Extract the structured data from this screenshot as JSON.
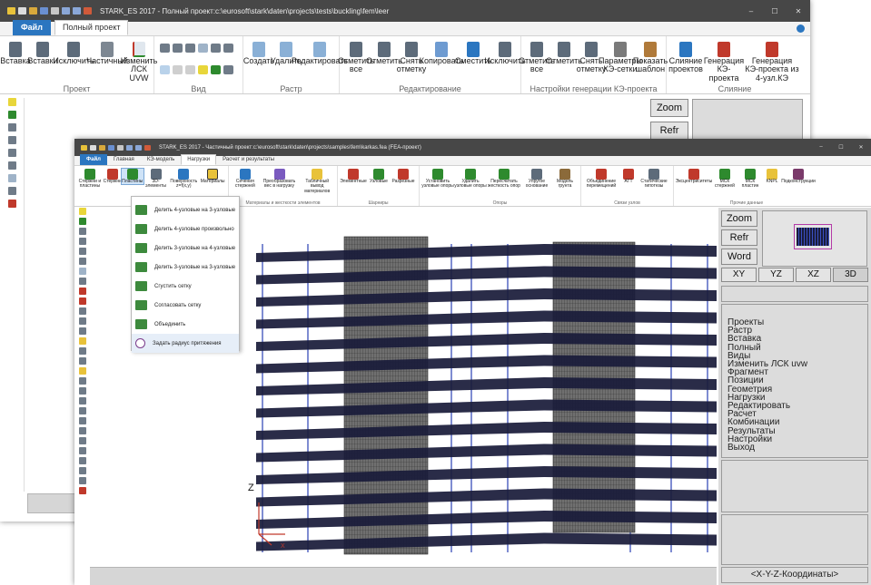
{
  "colors": {
    "titlebar": "#474747",
    "file_tab": "#2b76c0",
    "accent_green": "#2e8a2e",
    "model_slab": "#1a1c3a",
    "model_frame": "#2a3fb3",
    "panel_grey": "#dcdcdc"
  },
  "back_window": {
    "title": "STARK_ES 2017 - Полный проект:c:\\eurosoft\\stark\\daten\\projects\\tests\\buckling\\fem\\leer",
    "tabs": [
      "Файл",
      "Полный проект"
    ],
    "groups": [
      {
        "name": "Проект",
        "buttons": [
          "Вставка",
          "Вставки",
          "Исключить",
          "Частичный",
          "Изменить ЛСК UVW"
        ]
      },
      {
        "name": "Вид",
        "buttons": []
      },
      {
        "name": "Растр",
        "buttons": [
          "Создать",
          "Удалить",
          "Редактировать"
        ]
      },
      {
        "name": "Редактирование",
        "buttons": [
          "Отметить все",
          "Отметить",
          "Снять отметку",
          "Копировать",
          "Сместить",
          "Исключить"
        ]
      },
      {
        "name": "Настройки генерации КЭ-проекта",
        "buttons": [
          "Отметить все",
          "Отметить",
          "Снять отметку",
          "Параметры КЭ-сетки",
          "Показать шаблон"
        ]
      },
      {
        "name": "Слияние",
        "buttons": [
          "Слияние проектов",
          "Генерация КЭ-проекта",
          "Генерация КЭ-проекта из 4-узл.КЭ"
        ]
      }
    ],
    "side_buttons": [
      "Zoom",
      "Refr"
    ]
  },
  "front_window": {
    "title": "STARK_ES 2017 - Частичный проект:c:\\eurosoft\\stark\\daten\\projects\\samples\\fem\\karkas.fea (FEA-проект)",
    "tabs": [
      "Файл",
      "Главная",
      "КЭ-модель",
      "Нагрузки",
      "Расчет и результаты"
    ],
    "groups": [
      {
        "name": "",
        "buttons": [
          "Стержни и пластины",
          "Стержни",
          "Пластины",
          "3D-элементы",
          "Поверхность z=f(x,y)",
          "Материалы"
        ]
      },
      {
        "name": "Материалы и жесткости элементов",
        "buttons": [
          "Сечения стержней",
          "Преобразовать вес в нагрузку",
          "Табличный вывод материалов"
        ]
      },
      {
        "name": "Шарниры",
        "buttons": [
          "Элементные",
          "Узловые",
          "Разрезные"
        ]
      },
      {
        "name": "Опоры",
        "buttons": [
          "Установить узловые опоры",
          "Удалить узловые опоры",
          "Пересчитать жесткость опор",
          "Упругое основание",
          "Модель грунта"
        ]
      },
      {
        "name": "Связи узлов",
        "buttons": [
          "Объединение перемещений",
          "АТТ",
          "Статические гипотезы"
        ]
      },
      {
        "name": "Прочие данные",
        "buttons": [
          "Эксцентриситеты",
          "МСК стержней",
          "МСК пластин",
          "KNPL",
          "Подконструкции"
        ]
      }
    ],
    "dropdown": [
      "Делить 4-узловые на 3-узловые",
      "Делить 4-узловые произвольно",
      "Делить 3-узловые на 4-узловые",
      "Делить 3-узловые на 3-узловые",
      "Сгустить сетку",
      "Согласовать сетку",
      "Объединить",
      "Задать радиус притяжения"
    ],
    "right_panel": {
      "buttons": [
        "Zoom",
        "Refr",
        "Word"
      ],
      "views": [
        "XY",
        "YZ",
        "XZ",
        "3D"
      ],
      "menu": [
        "Проекты",
        "Растр",
        "Вставка",
        "Полный",
        "Виды",
        "Изменить ЛСК uvw",
        "Фрагмент",
        "Позиции",
        "Геометрия",
        "Нагрузки",
        "Редактировать",
        "Расчет",
        "Комбинации",
        "Результаты",
        "Настройки",
        "Выход"
      ],
      "status": "<X-Y-Z-Координаты>"
    },
    "axes": {
      "z": "Z",
      "x": "X"
    }
  }
}
